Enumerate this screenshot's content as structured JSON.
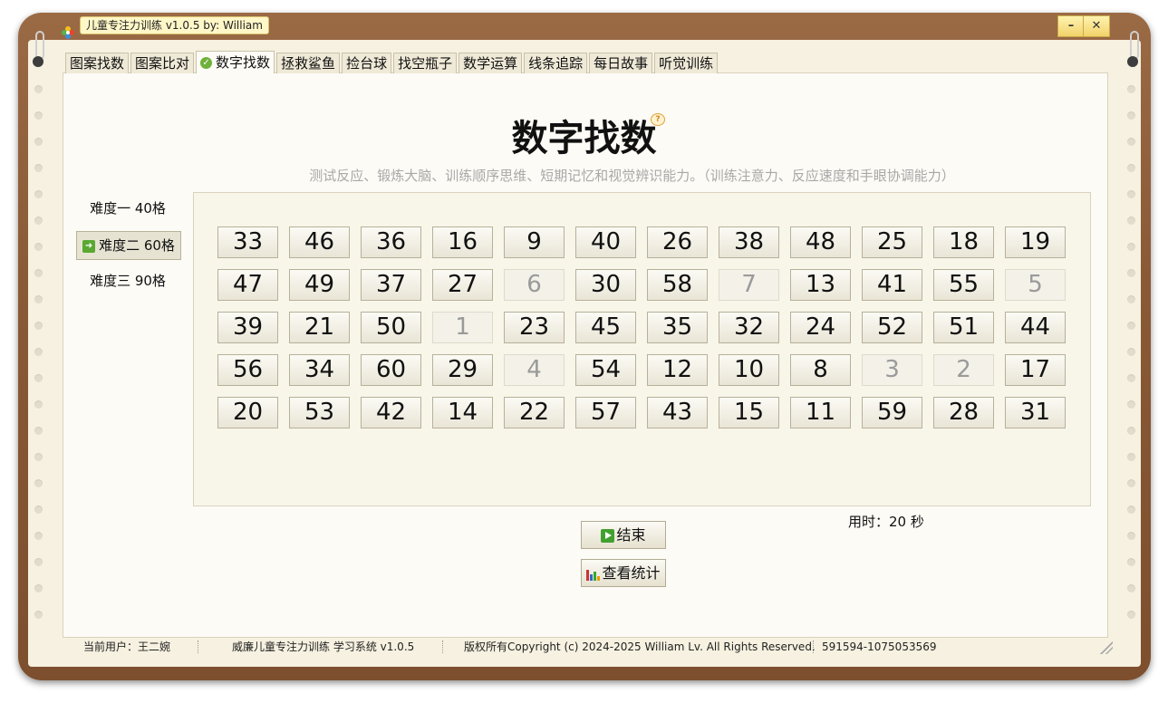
{
  "window": {
    "title": "儿童专注力训练 v1.0.5 by: William",
    "minimize_label": "–",
    "close_label": "✕"
  },
  "tabs": [
    {
      "label": "图案找数",
      "active": false
    },
    {
      "label": "图案比对",
      "active": false
    },
    {
      "label": "数字找数",
      "active": true
    },
    {
      "label": "拯救鲨鱼",
      "active": false
    },
    {
      "label": "捡台球",
      "active": false
    },
    {
      "label": "找空瓶子",
      "active": false
    },
    {
      "label": "数学运算",
      "active": false
    },
    {
      "label": "线条追踪",
      "active": false
    },
    {
      "label": "每日故事",
      "active": false
    },
    {
      "label": "听觉训练",
      "active": false
    }
  ],
  "main": {
    "title": "数字找数",
    "help_icon": "?",
    "subtitle": "测试反应、锻炼大脑、训练顺序思维、短期记忆和视觉辨识能力。（训练注意力、反应速度和手眼协调能力）"
  },
  "levels": [
    {
      "label": "难度一  40格",
      "selected": false
    },
    {
      "label": "难度二  60格",
      "selected": true
    },
    {
      "label": "难度三  90格",
      "selected": false
    }
  ],
  "grid": {
    "columns": 12,
    "rows": [
      [
        33,
        46,
        36,
        16,
        9,
        40,
        26,
        38,
        48,
        25,
        18,
        19
      ],
      [
        47,
        49,
        37,
        27,
        6,
        30,
        58,
        7,
        13,
        41,
        55,
        5
      ],
      [
        39,
        21,
        50,
        1,
        23,
        45,
        35,
        32,
        24,
        52,
        51,
        44
      ],
      [
        56,
        34,
        60,
        29,
        4,
        54,
        12,
        10,
        8,
        3,
        2,
        17
      ],
      [
        20,
        53,
        42,
        14,
        22,
        57,
        43,
        15,
        11,
        59,
        28,
        31
      ]
    ],
    "completed": [
      1,
      2,
      3,
      4,
      5,
      6,
      7
    ]
  },
  "timer": {
    "label": "用时：20 秒"
  },
  "buttons": {
    "end_label": "结束",
    "stats_label": "查看统计"
  },
  "statusbar": {
    "user": "当前用户：王二婉",
    "app": "威廉儿童专注力训练 学习系统 v1.0.5",
    "copyright": "版权所有Copyright (c) 2024-2025 William Lv. All Rights Reserved.",
    "contact": "591594-1075053569"
  },
  "colors": {
    "frame": "#8a5a36",
    "paper": "#f6f1e0",
    "accent_green": "#42a030"
  }
}
